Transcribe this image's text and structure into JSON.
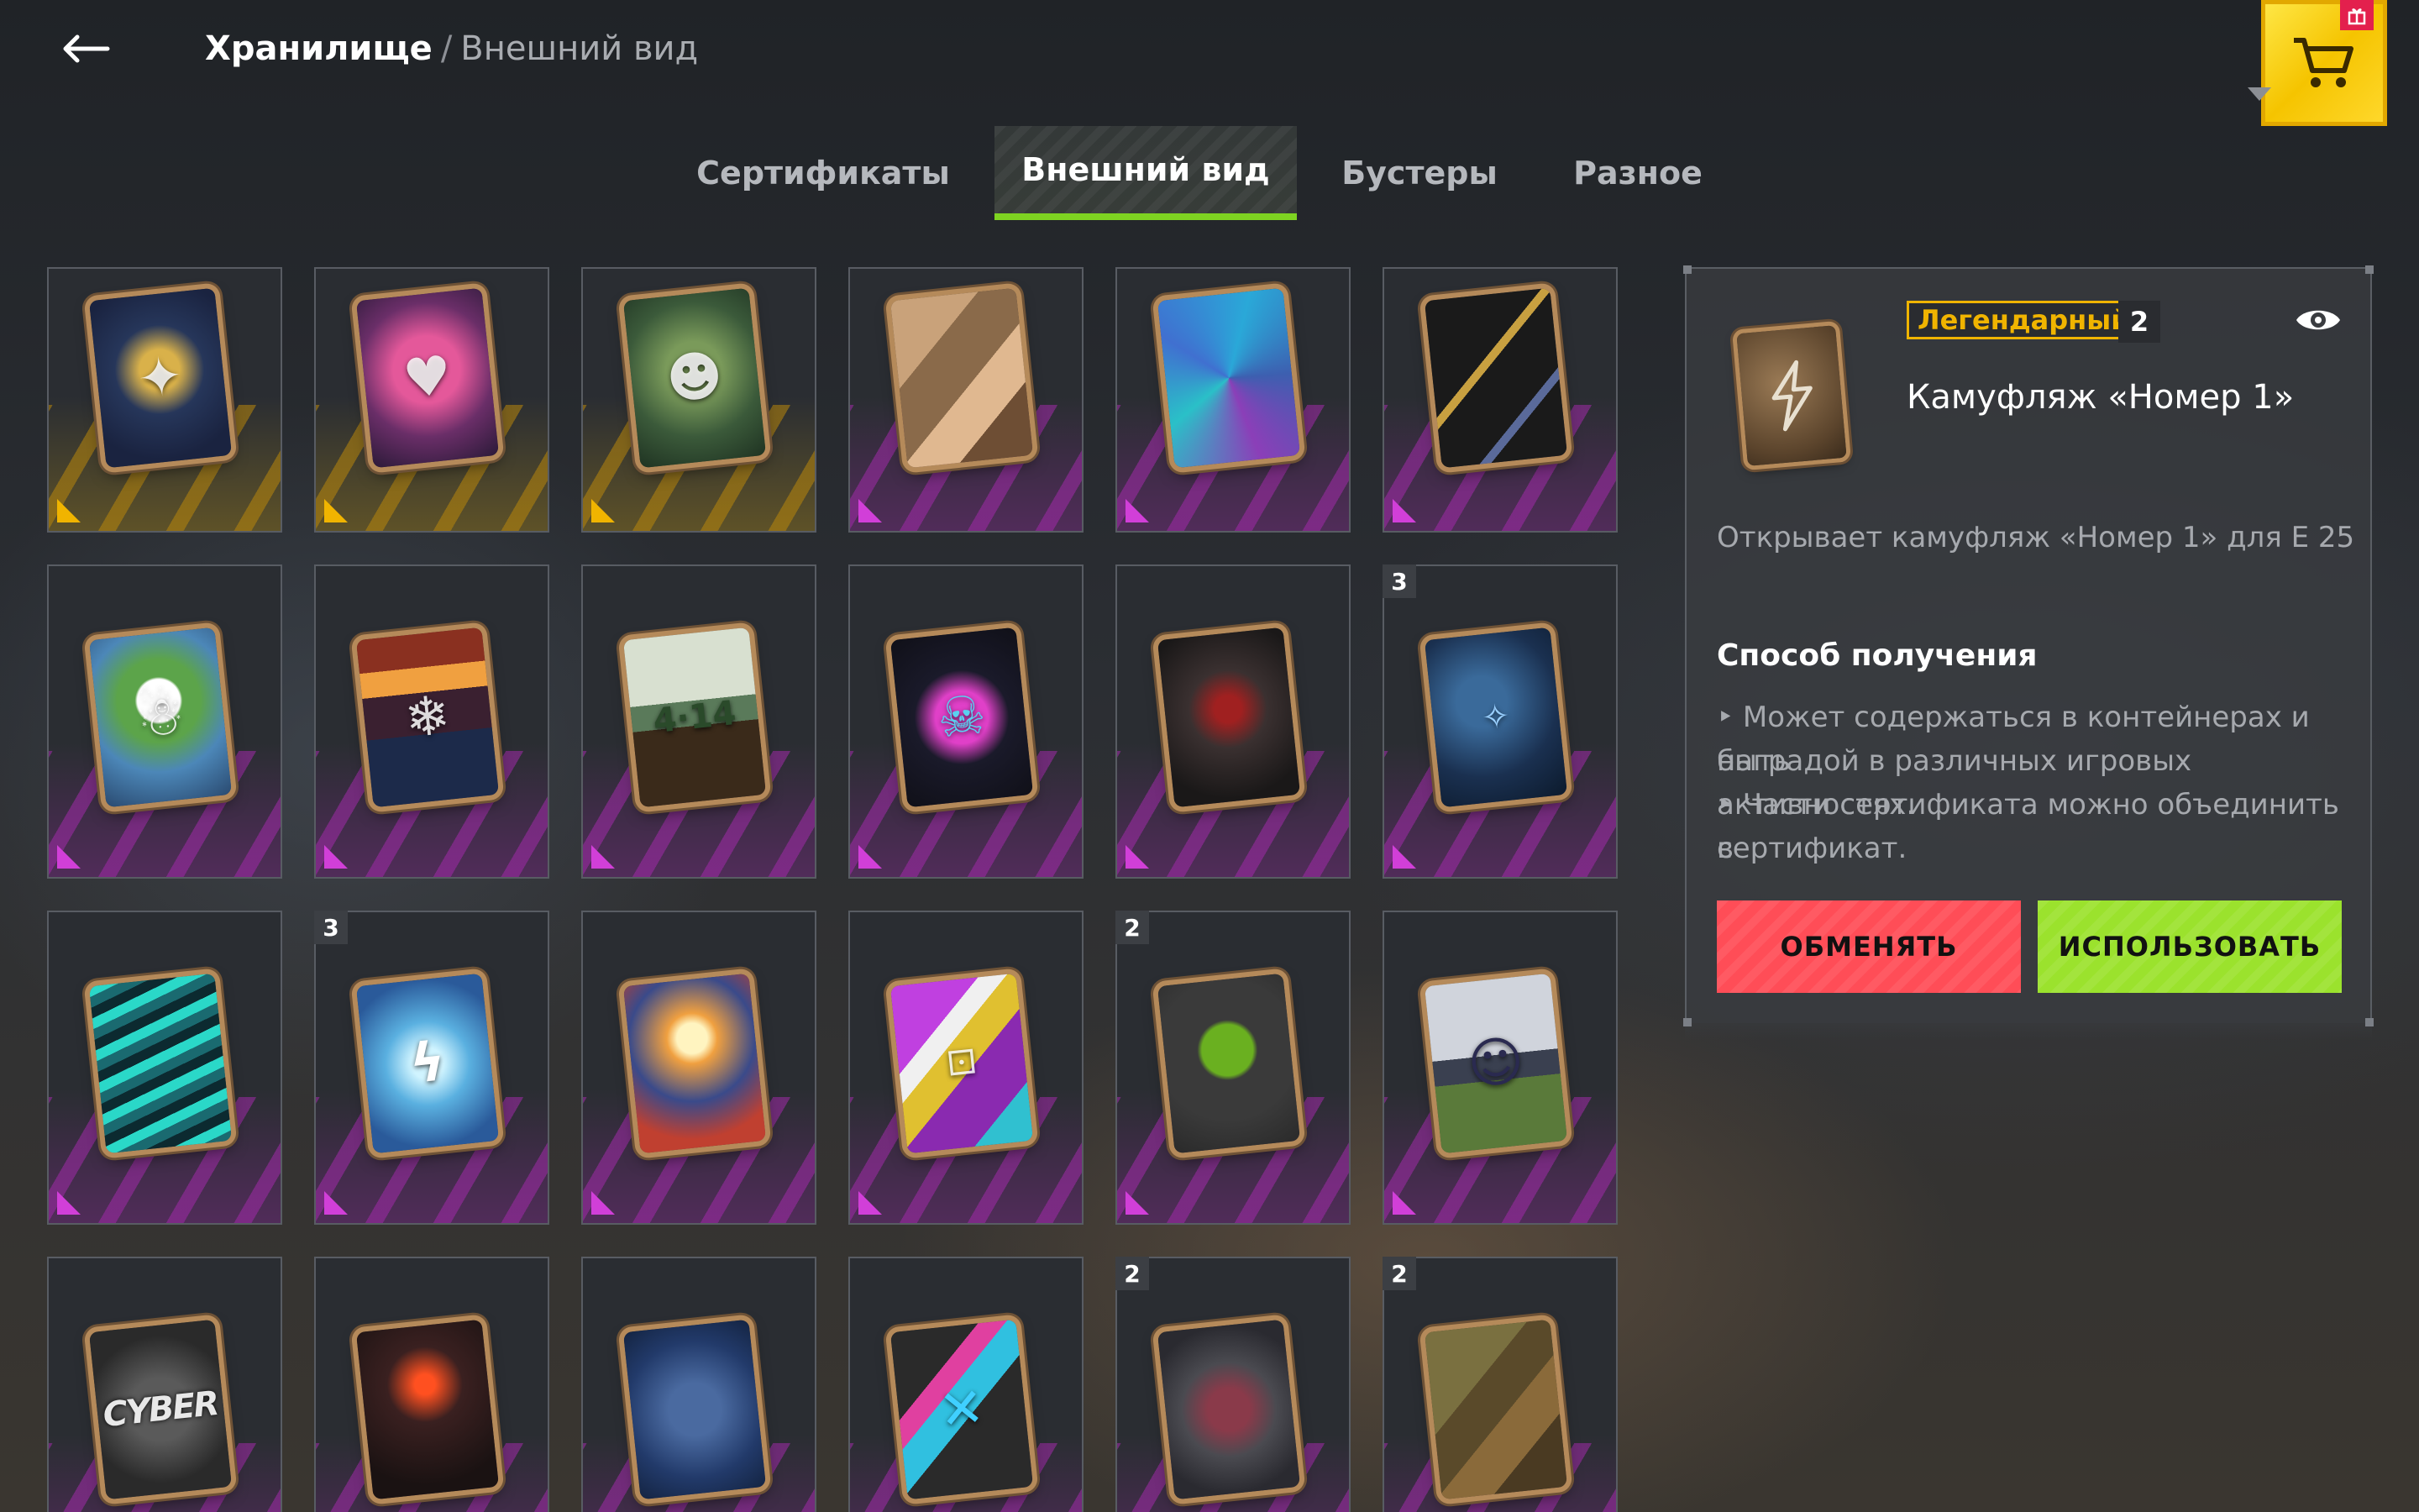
{
  "header": {
    "back_label": "←",
    "breadcrumb_root": "Хранилище",
    "breadcrumb_sep": "/",
    "breadcrumb_current": "Внешний вид"
  },
  "tabs": [
    {
      "label": "Сертификаты",
      "active": false
    },
    {
      "label": "Внешний вид",
      "active": true
    },
    {
      "label": "Бустеры",
      "active": false
    },
    {
      "label": "Разное",
      "active": false
    }
  ],
  "colors": {
    "accent_green": "#7ed321",
    "rarity_legendary": "#f0b400",
    "rarity_epic": "#d13fd8",
    "button_exchange": "#ff4d57",
    "button_use": "#9be22d"
  },
  "grid": {
    "badges": {
      "r2c6": "3",
      "r3c2": "3",
      "r3c5": "2",
      "r4c5": "2",
      "r4c6": "2"
    },
    "cyber_text": "CYBER"
  },
  "details": {
    "rarity": "Легендарный",
    "count": "2",
    "title": "Камуфляж «Номер 1»",
    "description": "Открывает камуфляж «Номер 1» для E 25",
    "how_to_get_title": "Способ получения",
    "bullet1_line1": "‣ Может содержаться в контейнерах и быть",
    "bullet1_line2": "наградой в различных игровых активностях.",
    "bullet2_line1": "‣ Части сертификата можно объединить в",
    "bullet2_line2": "сертификат.",
    "exchange_label": "ОБМЕНЯТЬ",
    "use_label": "ИСПОЛЬЗОВАТЬ"
  }
}
